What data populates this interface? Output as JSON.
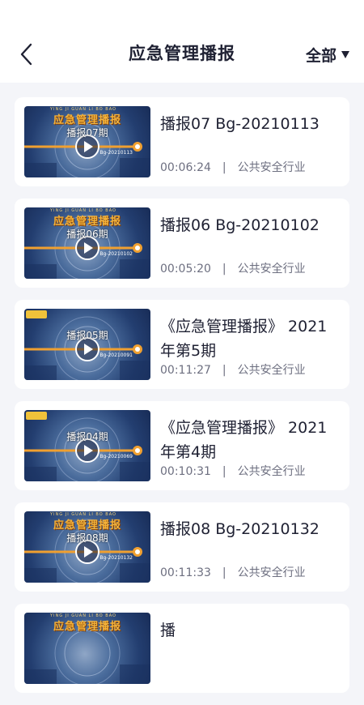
{
  "header": {
    "title": "应急管理播报",
    "filter_label": "全部"
  },
  "thumbnail": {
    "banner": "应急管理播报",
    "banner_sub": "YING JI GUAN LI BO BAO"
  },
  "items": [
    {
      "title": "播报07 Bg-20210113",
      "duration": "00:06:24",
      "separator": "|",
      "category": "公共安全行业",
      "thumb_label": "播报07期",
      "thumb_code": "Bg-20210113",
      "banner_style": "banner"
    },
    {
      "title": "播报06 Bg-20210102",
      "duration": "00:05:20",
      "separator": "|",
      "category": "公共安全行业",
      "thumb_label": "播报06期",
      "thumb_code": "Bg-20210102",
      "banner_style": "banner"
    },
    {
      "title": "《应急管理播报》 2021年第5期",
      "duration": "00:11:27",
      "separator": "|",
      "category": "公共安全行业",
      "thumb_label": "播报05期",
      "thumb_code": "Bg-20210091",
      "banner_style": "logo"
    },
    {
      "title": "《应急管理播报》 2021年第4期",
      "duration": "00:10:31",
      "separator": "|",
      "category": "公共安全行业",
      "thumb_label": "播报04期",
      "thumb_code": "Bg-20210069",
      "banner_style": "logo"
    },
    {
      "title": "播报08 Bg-20210132",
      "duration": "00:11:33",
      "separator": "|",
      "category": "公共安全行业",
      "thumb_label": "播报08期",
      "thumb_code": "Bg-20210132",
      "banner_style": "banner"
    },
    {
      "title": "播",
      "duration": "",
      "separator": "",
      "category": "",
      "thumb_label": "",
      "thumb_code": "",
      "banner_style": "banner"
    }
  ]
}
